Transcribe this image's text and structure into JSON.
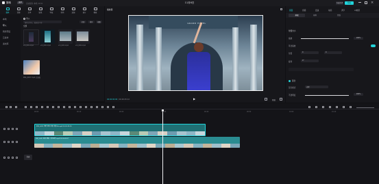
{
  "app": {
    "name": "剪映",
    "menu_label": "菜单",
    "autosave": "自动保存 本地 20:51",
    "title": "11月6日"
  },
  "window": {
    "layout_label": "Layout",
    "export_label": "导出"
  },
  "toolbar": {
    "items": [
      {
        "label": "媒体",
        "active": true
      },
      {
        "label": "音频"
      },
      {
        "label": "文本"
      },
      {
        "label": "贴纸"
      },
      {
        "label": "特效"
      },
      {
        "label": "转场"
      },
      {
        "label": "滤镜"
      },
      {
        "label": "调节"
      },
      {
        "label": "模板"
      }
    ]
  },
  "leftnav": {
    "items": [
      "本地",
      "导入",
      "我的预设",
      "云素材",
      "素材库"
    ],
    "active_index": 1
  },
  "media": {
    "search_placeholder": "搜索文件名、描述或人物",
    "import_label": "导入",
    "filters": [
      "全部",
      "排序",
      "视图"
    ],
    "section_label": "全部",
    "items": [
      {
        "name": "vid_001.mp4",
        "duration": "00:08"
      },
      {
        "name": "vid_002.mp4",
        "duration": "00:15"
      },
      {
        "name": "vid_003.mp4",
        "duration": "00:06"
      },
      {
        "name": "vid_004.mp4",
        "duration": "00:11"
      }
    ],
    "last_item_label": "IMG_0457.mp4  已添加"
  },
  "player": {
    "title": "播放器",
    "time_current": "00:00:00:00",
    "time_total": "00:00:45:12",
    "ratio_label": "原始",
    "video_sign": "GRAND HOTEL"
  },
  "properties": {
    "tabs": [
      "画面",
      "音频",
      "变速",
      "动画",
      "调节",
      "AI效果"
    ],
    "active_tab_index": 0,
    "subtabs": [
      "基础",
      "抠像",
      "蒙版"
    ],
    "section_title": "位置大小",
    "rows": [
      {
        "label": "缩放",
        "value": "100%"
      },
      {
        "label": "等比缩放",
        "value": ""
      },
      {
        "label": "位置",
        "value": "0"
      },
      {
        "label": "旋转",
        "value": "0°"
      }
    ],
    "blend_title": "混合",
    "blend_mode_label": "混合模式",
    "blend_mode_value": "正常",
    "opacity_label": "不透明度",
    "opacity_value": "100%",
    "scale_percent": 1.0
  },
  "timeline": {
    "ruler": [
      "00:00",
      "00:10",
      "00:20",
      "00:30",
      "00:40",
      "00:50",
      "01:00",
      "01:10"
    ],
    "clip1_label": "IMG_0423 河畔 游玩 风景 高清 4k.mp4  00:00:28:14",
    "clip2_label": "IMG_0431 城市 街拍 人物 夏日.mp4  00:00:42:07",
    "cover_label": "封面"
  },
  "colors": {
    "accent": "#22d3da",
    "clip1": "#1f6f73",
    "clip2": "#2a8c91"
  }
}
